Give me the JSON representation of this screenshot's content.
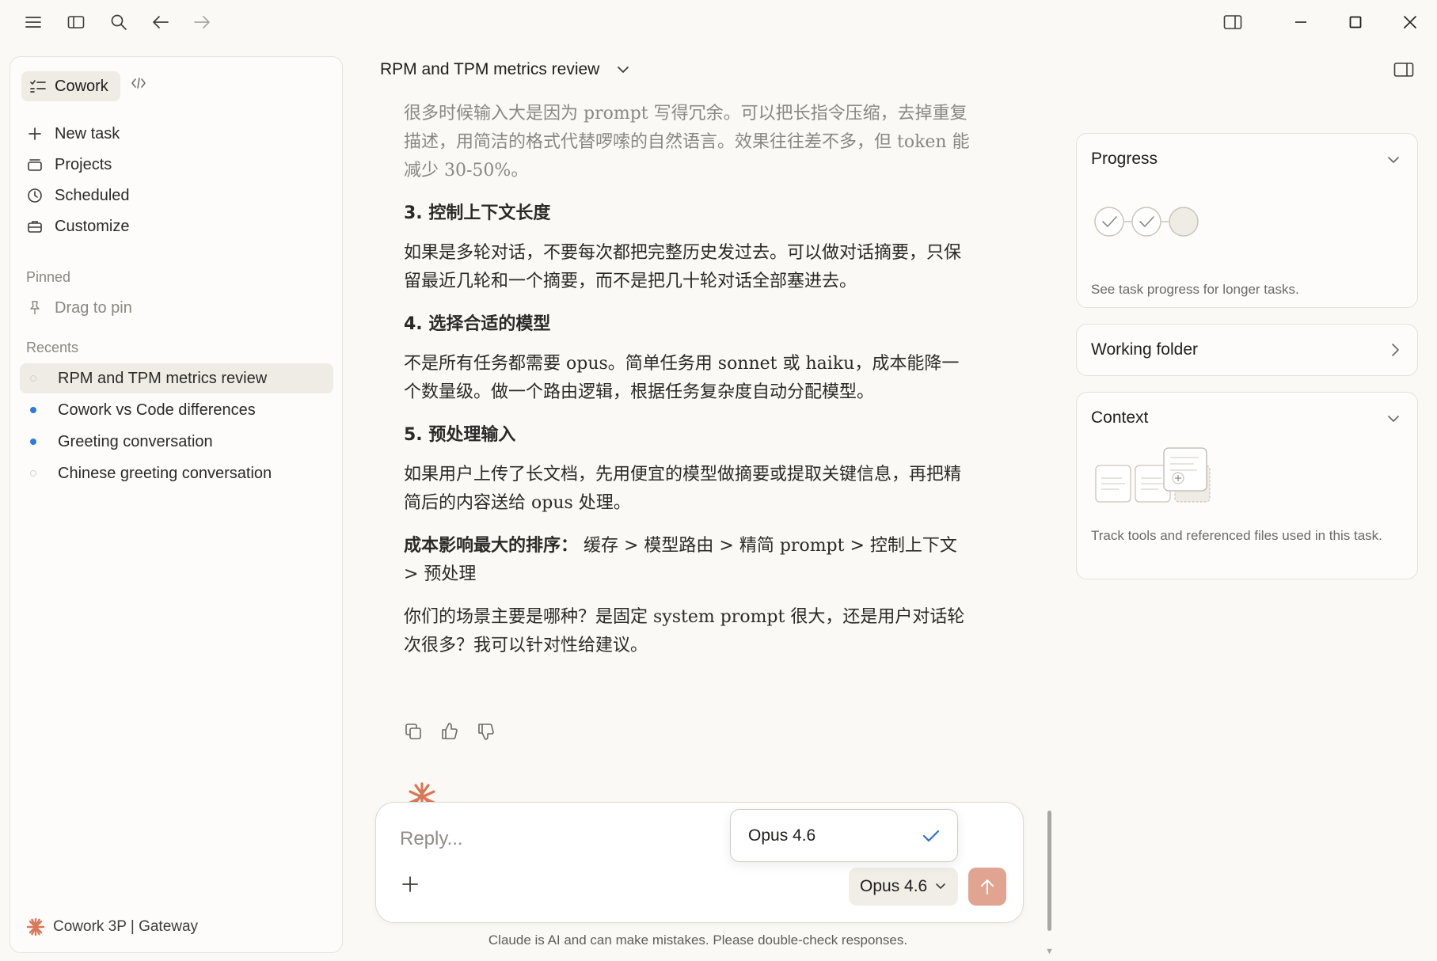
{
  "chat": {
    "title": "RPM and TPM metrics review"
  },
  "sidebar": {
    "mode_label": "Cowork",
    "nav": [
      {
        "label": "New task",
        "icon": "plus-icon"
      },
      {
        "label": "Projects",
        "icon": "projects-icon"
      },
      {
        "label": "Scheduled",
        "icon": "clock-icon"
      },
      {
        "label": "Customize",
        "icon": "briefcase-icon"
      }
    ],
    "pinned_label": "Pinned",
    "pin_hint": "Drag to pin",
    "recents_label": "Recents",
    "recents": [
      {
        "label": "RPM and TPM metrics review",
        "status": "idle",
        "active": true
      },
      {
        "label": "Cowork vs Code differences",
        "status": "unread",
        "active": false
      },
      {
        "label": "Greeting conversation",
        "status": "unread",
        "active": false
      },
      {
        "label": "Chinese greeting conversation",
        "status": "idle",
        "active": false
      }
    ],
    "footer_label": "Cowork 3P | Gateway"
  },
  "message": {
    "p_intro": "很多时候输入大是因为 prompt 写得冗余。可以把长指令压缩，去掉重复描述，用简洁的格式代替啰嗦的自然语言。效果往往差不多，但 token 能减少 30-50%。",
    "h3": "3. 控制上下文长度",
    "p3": "如果是多轮对话，不要每次都把完整历史发过去。可以做对话摘要，只保留最近几轮和一个摘要，而不是把几十轮对话全部塞进去。",
    "h4": "4. 选择合适的模型",
    "p4": "不是所有任务都需要 opus。简单任务用 sonnet 或 haiku，成本能降一个数量级。做一个路由逻辑，根据任务复杂度自动分配模型。",
    "h5": "5. 预处理输入",
    "p5": "如果用户上传了长文档，先用便宜的模型做摘要或提取关键信息，再把精简后的内容送给 opus 处理。",
    "ranking_label": "成本影响最大的排序：",
    "ranking_text": "缓存 > 模型路由 > 精简 prompt > 控制上下文 > 预处理",
    "closing": "你们的场景主要是哪种？是固定 system prompt 很大，还是用户对话轮次很多？我可以针对性给建议。"
  },
  "composer": {
    "placeholder": "Reply...",
    "model_label": "Opus 4.6",
    "popup_option": "Opus 4.6"
  },
  "disclaimer": "Claude is AI and can make mistakes. Please double-check responses.",
  "panel": {
    "progress_title": "Progress",
    "progress_desc": "See task progress for longer tasks.",
    "working_folder_title": "Working folder",
    "context_title": "Context",
    "context_desc": "Track tools and referenced files used in this task."
  },
  "colors": {
    "accent": "#d97757",
    "send_button": "#e0a491",
    "unread_dot": "#2f7bd9"
  }
}
